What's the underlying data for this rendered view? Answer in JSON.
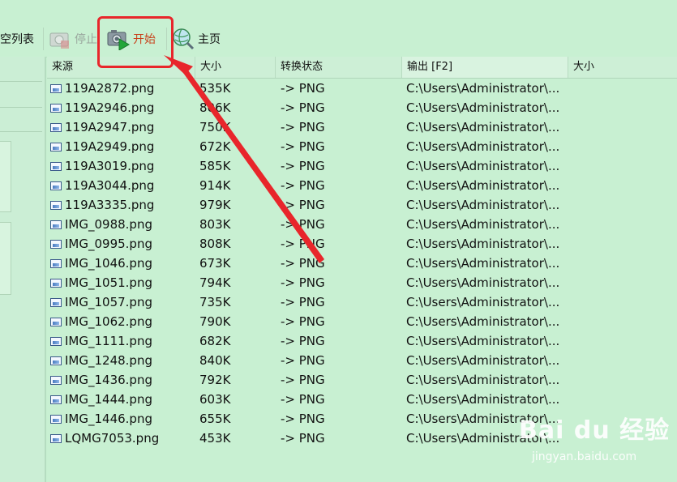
{
  "toolbar": {
    "clear_list_label": "空列表",
    "stop_label": "停止",
    "start_label": "开始",
    "home_label": "主页",
    "start_color": "#c8401a",
    "highlight_color": "#e8262b"
  },
  "columns": [
    {
      "key": "source",
      "label": "来源"
    },
    {
      "key": "size",
      "label": "大小"
    },
    {
      "key": "status",
      "label": "转换状态"
    },
    {
      "key": "output",
      "label": "输出 [F2]"
    },
    {
      "key": "out_size",
      "label": "大小"
    }
  ],
  "rows": [
    {
      "name": "119A2872.png",
      "size": "535K",
      "status": "-> PNG",
      "output": "C:\\Users\\Administrator\\..."
    },
    {
      "name": "119A2946.png",
      "size": "806K",
      "status": "-> PNG",
      "output": "C:\\Users\\Administrator\\..."
    },
    {
      "name": "119A2947.png",
      "size": "750K",
      "status": "-> PNG",
      "output": "C:\\Users\\Administrator\\..."
    },
    {
      "name": "119A2949.png",
      "size": "672K",
      "status": "-> PNG",
      "output": "C:\\Users\\Administrator\\..."
    },
    {
      "name": "119A3019.png",
      "size": "585K",
      "status": "-> PNG",
      "output": "C:\\Users\\Administrator\\..."
    },
    {
      "name": "119A3044.png",
      "size": "914K",
      "status": "-> PNG",
      "output": "C:\\Users\\Administrator\\..."
    },
    {
      "name": "119A3335.png",
      "size": "979K",
      "status": "-> PNG",
      "output": "C:\\Users\\Administrator\\..."
    },
    {
      "name": "IMG_0988.png",
      "size": "803K",
      "status": "-> PNG",
      "output": "C:\\Users\\Administrator\\..."
    },
    {
      "name": "IMG_0995.png",
      "size": "808K",
      "status": "-> PNG",
      "output": "C:\\Users\\Administrator\\..."
    },
    {
      "name": "IMG_1046.png",
      "size": "673K",
      "status": "-> PNG",
      "output": "C:\\Users\\Administrator\\..."
    },
    {
      "name": "IMG_1051.png",
      "size": "794K",
      "status": "-> PNG",
      "output": "C:\\Users\\Administrator\\..."
    },
    {
      "name": "IMG_1057.png",
      "size": "735K",
      "status": "-> PNG",
      "output": "C:\\Users\\Administrator\\..."
    },
    {
      "name": "IMG_1062.png",
      "size": "790K",
      "status": "-> PNG",
      "output": "C:\\Users\\Administrator\\..."
    },
    {
      "name": "IMG_1111.png",
      "size": "682K",
      "status": "-> PNG",
      "output": "C:\\Users\\Administrator\\..."
    },
    {
      "name": "IMG_1248.png",
      "size": "840K",
      "status": "-> PNG",
      "output": "C:\\Users\\Administrator\\..."
    },
    {
      "name": "IMG_1436.png",
      "size": "792K",
      "status": "-> PNG",
      "output": "C:\\Users\\Administrator\\..."
    },
    {
      "name": "IMG_1444.png",
      "size": "603K",
      "status": "-> PNG",
      "output": "C:\\Users\\Administrator\\..."
    },
    {
      "name": "IMG_1446.png",
      "size": "655K",
      "status": "-> PNG",
      "output": "C:\\Users\\Administrator\\..."
    },
    {
      "name": "LQMG7053.png",
      "size": "453K",
      "status": "-> PNG",
      "output": "C:\\Users\\Administrator\\..."
    }
  ],
  "watermark": {
    "logo": "Bai du 经验",
    "url": "jingyan.baidu.com"
  }
}
